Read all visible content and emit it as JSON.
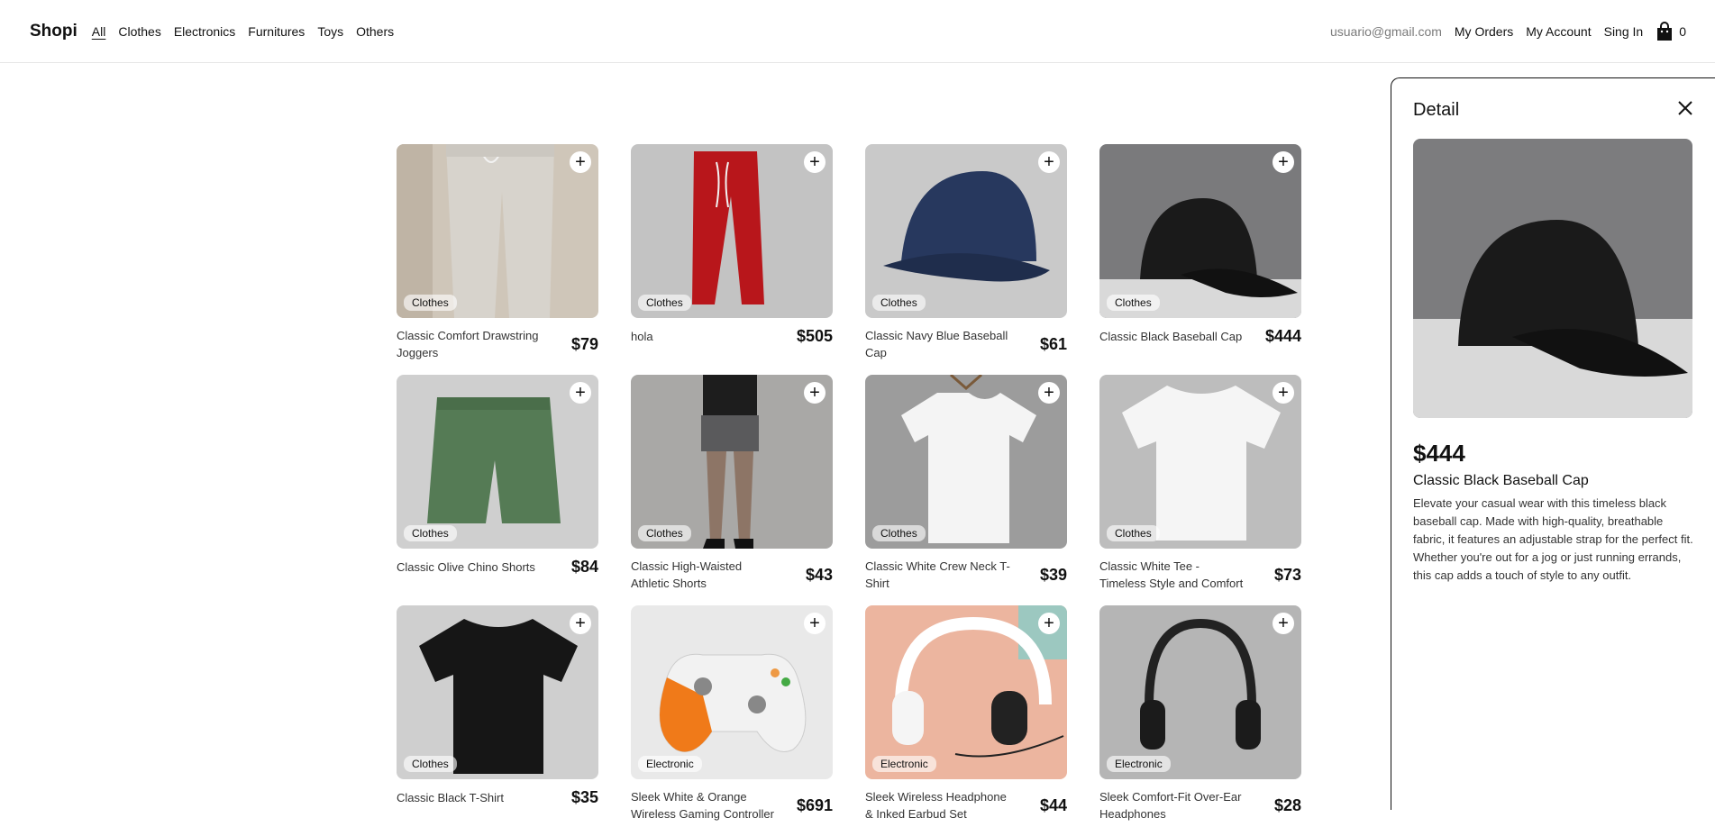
{
  "nav": {
    "brand": "Shopi",
    "links": [
      "All",
      "Clothes",
      "Electronics",
      "Furnitures",
      "Toys",
      "Others"
    ],
    "email": "usuario@gmail.com",
    "my_orders": "My Orders",
    "my_account": "My Account",
    "sign_in": "Sing In",
    "cart_count": "0"
  },
  "products": [
    {
      "name": "Classic Comfort Drawstring Joggers",
      "price": "$79",
      "category": "Clothes"
    },
    {
      "name": "hola",
      "price": "$505",
      "category": "Clothes"
    },
    {
      "name": "Classic Navy Blue Baseball Cap",
      "price": "$61",
      "category": "Clothes"
    },
    {
      "name": "Classic Black Baseball Cap",
      "price": "$444",
      "category": "Clothes"
    },
    {
      "name": "Classic Olive Chino Shorts",
      "price": "$84",
      "category": "Clothes"
    },
    {
      "name": "Classic High-Waisted Athletic Shorts",
      "price": "$43",
      "category": "Clothes"
    },
    {
      "name": "Classic White Crew Neck T-Shirt",
      "price": "$39",
      "category": "Clothes"
    },
    {
      "name": "Classic White Tee - Timeless Style and Comfort",
      "price": "$73",
      "category": "Clothes"
    },
    {
      "name": "Classic Black T-Shirt",
      "price": "$35",
      "category": "Clothes"
    },
    {
      "name": "Sleek White & Orange Wireless Gaming Controller",
      "price": "$691",
      "category": "Electronic"
    },
    {
      "name": "Sleek Wireless Headphone & Inked Earbud Set",
      "price": "$44",
      "category": "Electronic"
    },
    {
      "name": "Sleek Comfort-Fit Over-Ear Headphones",
      "price": "$28",
      "category": "Electronic"
    }
  ],
  "detail": {
    "title": "Detail",
    "price": "$444",
    "name": "Classic Black Baseball Cap",
    "description": "Elevate your casual wear with this timeless black baseball cap. Made with high-quality, breathable fabric, it features an adjustable strap for the perfect fit. Whether you're out for a jog or just running errands, this cap adds a touch of style to any outfit."
  }
}
